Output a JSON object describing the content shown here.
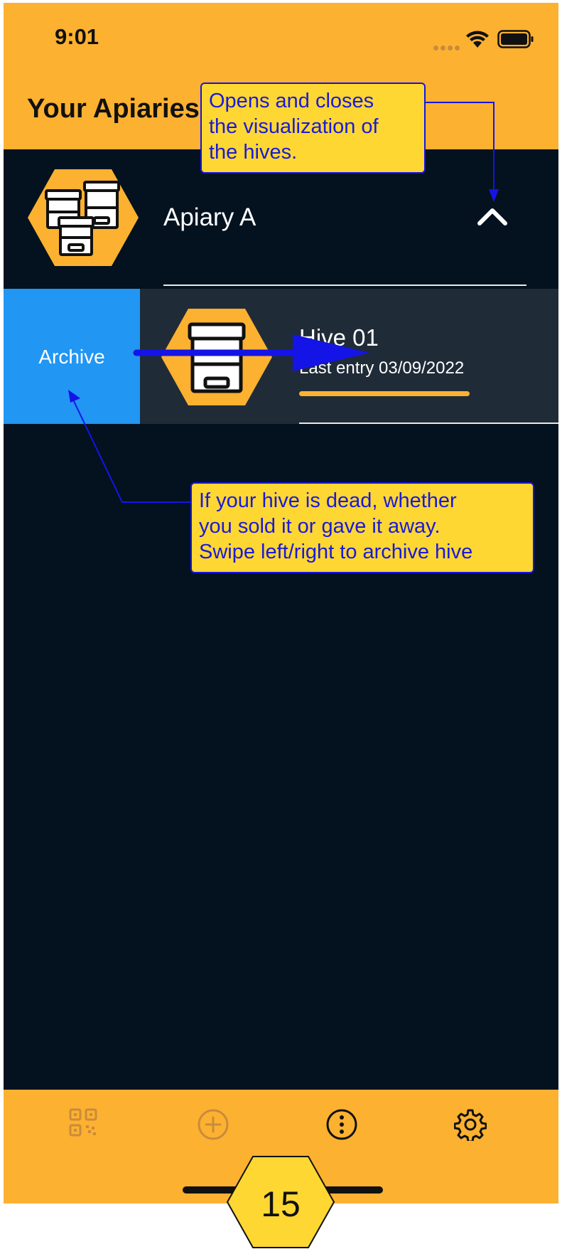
{
  "status_bar": {
    "time": "9:01"
  },
  "header": {
    "title": "Your Apiaries"
  },
  "apiary": {
    "name": "Apiary A"
  },
  "swipe_action": {
    "label": "Archive"
  },
  "hive": {
    "name": "Hive 01",
    "last_entry": "Last entry 03/09/2022"
  },
  "tabbar": {
    "icons": [
      "qr-code-icon",
      "add-circle-icon",
      "more-options-icon",
      "settings-gear-icon"
    ]
  },
  "annotations": {
    "toggle_note": [
      "Opens and closes",
      "the visualization of",
      "the hives."
    ],
    "archive_note": [
      "If your hive is dead, whether",
      "you sold it or gave it away.",
      "Swipe left/right to archive hive"
    ]
  },
  "page_number": "15",
  "colors": {
    "accent": "#fdb130",
    "background": "#04121f",
    "hive_row": "#202b38",
    "archive": "#2196f3",
    "callout_bg": "#fed732",
    "callout_text": "#1a1ad8"
  }
}
